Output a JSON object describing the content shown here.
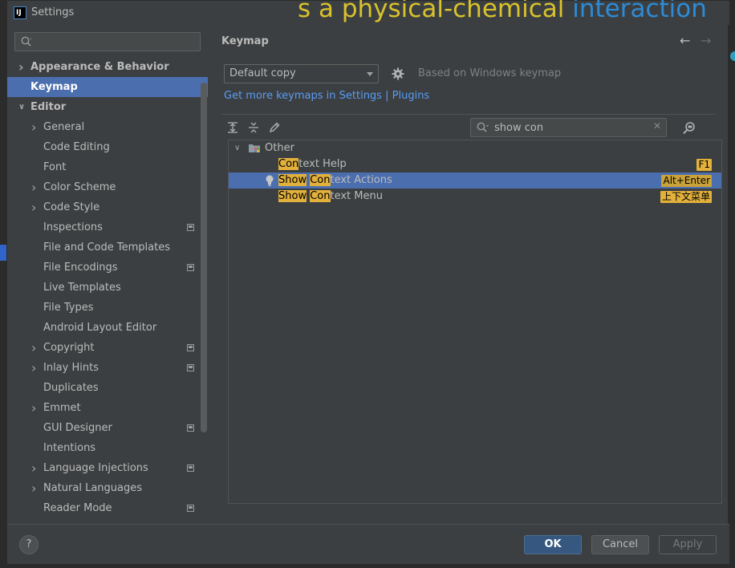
{
  "window": {
    "title": "Settings",
    "overlay_text_yellow": "s a physical-chemical",
    "overlay_text_blue": "interaction"
  },
  "sidebar": {
    "search_placeholder": "",
    "items": [
      {
        "label": "Appearance & Behavior",
        "level": 0,
        "chevron": "right",
        "bold": true,
        "selected": false,
        "project_icon": false
      },
      {
        "label": "Keymap",
        "level": 0,
        "chevron": "",
        "bold": true,
        "selected": true,
        "project_icon": false
      },
      {
        "label": "Editor",
        "level": 0,
        "chevron": "down",
        "bold": true,
        "selected": false,
        "project_icon": false
      },
      {
        "label": "General",
        "level": 1,
        "chevron": "right",
        "bold": false,
        "selected": false,
        "project_icon": false
      },
      {
        "label": "Code Editing",
        "level": 1,
        "chevron": "",
        "bold": false,
        "selected": false,
        "project_icon": false
      },
      {
        "label": "Font",
        "level": 1,
        "chevron": "",
        "bold": false,
        "selected": false,
        "project_icon": false
      },
      {
        "label": "Color Scheme",
        "level": 1,
        "chevron": "right",
        "bold": false,
        "selected": false,
        "project_icon": false
      },
      {
        "label": "Code Style",
        "level": 1,
        "chevron": "right",
        "bold": false,
        "selected": false,
        "project_icon": false
      },
      {
        "label": "Inspections",
        "level": 1,
        "chevron": "",
        "bold": false,
        "selected": false,
        "project_icon": true
      },
      {
        "label": "File and Code Templates",
        "level": 1,
        "chevron": "",
        "bold": false,
        "selected": false,
        "project_icon": false
      },
      {
        "label": "File Encodings",
        "level": 1,
        "chevron": "",
        "bold": false,
        "selected": false,
        "project_icon": true
      },
      {
        "label": "Live Templates",
        "level": 1,
        "chevron": "",
        "bold": false,
        "selected": false,
        "project_icon": false
      },
      {
        "label": "File Types",
        "level": 1,
        "chevron": "",
        "bold": false,
        "selected": false,
        "project_icon": false
      },
      {
        "label": "Android Layout Editor",
        "level": 1,
        "chevron": "",
        "bold": false,
        "selected": false,
        "project_icon": false
      },
      {
        "label": "Copyright",
        "level": 1,
        "chevron": "right",
        "bold": false,
        "selected": false,
        "project_icon": true
      },
      {
        "label": "Inlay Hints",
        "level": 1,
        "chevron": "right",
        "bold": false,
        "selected": false,
        "project_icon": true
      },
      {
        "label": "Duplicates",
        "level": 1,
        "chevron": "",
        "bold": false,
        "selected": false,
        "project_icon": false
      },
      {
        "label": "Emmet",
        "level": 1,
        "chevron": "right",
        "bold": false,
        "selected": false,
        "project_icon": false
      },
      {
        "label": "GUI Designer",
        "level": 1,
        "chevron": "",
        "bold": false,
        "selected": false,
        "project_icon": true
      },
      {
        "label": "Intentions",
        "level": 1,
        "chevron": "",
        "bold": false,
        "selected": false,
        "project_icon": false
      },
      {
        "label": "Language Injections",
        "level": 1,
        "chevron": "right",
        "bold": false,
        "selected": false,
        "project_icon": true
      },
      {
        "label": "Natural Languages",
        "level": 1,
        "chevron": "right",
        "bold": false,
        "selected": false,
        "project_icon": false
      },
      {
        "label": "Reader Mode",
        "level": 1,
        "chevron": "",
        "bold": false,
        "selected": false,
        "project_icon": true
      }
    ]
  },
  "main": {
    "title": "Keymap",
    "keymap_select": "Default copy",
    "based_on": "Based on Windows keymap",
    "link_settings": "Get more keymaps in Settings",
    "link_sep": "|",
    "link_plugins": "Plugins",
    "filter_value": "show con",
    "tree": [
      {
        "type": "group",
        "label": "Other"
      },
      {
        "type": "action",
        "highlight": "Con",
        "prefix": "",
        "rest": "text Help",
        "shortcut": "F1",
        "selected": false,
        "bulb": false
      },
      {
        "type": "action",
        "highlight_show": "Show",
        "highlight": "Con",
        "rest": "text Actions",
        "shortcut": "Alt+Enter",
        "selected": true,
        "bulb": true
      },
      {
        "type": "action",
        "highlight_show": "Show",
        "highlight": "Con",
        "rest": "text Menu",
        "shortcut": "上下文菜单",
        "selected": false,
        "bulb": false
      }
    ]
  },
  "footer": {
    "help": "?",
    "ok": "OK",
    "cancel": "Cancel",
    "apply": "Apply"
  },
  "colors": {
    "selection": "#4b6eaf",
    "highlight": "#e2b13c",
    "link": "#589df6",
    "dialog_bg": "#3c3f41"
  }
}
